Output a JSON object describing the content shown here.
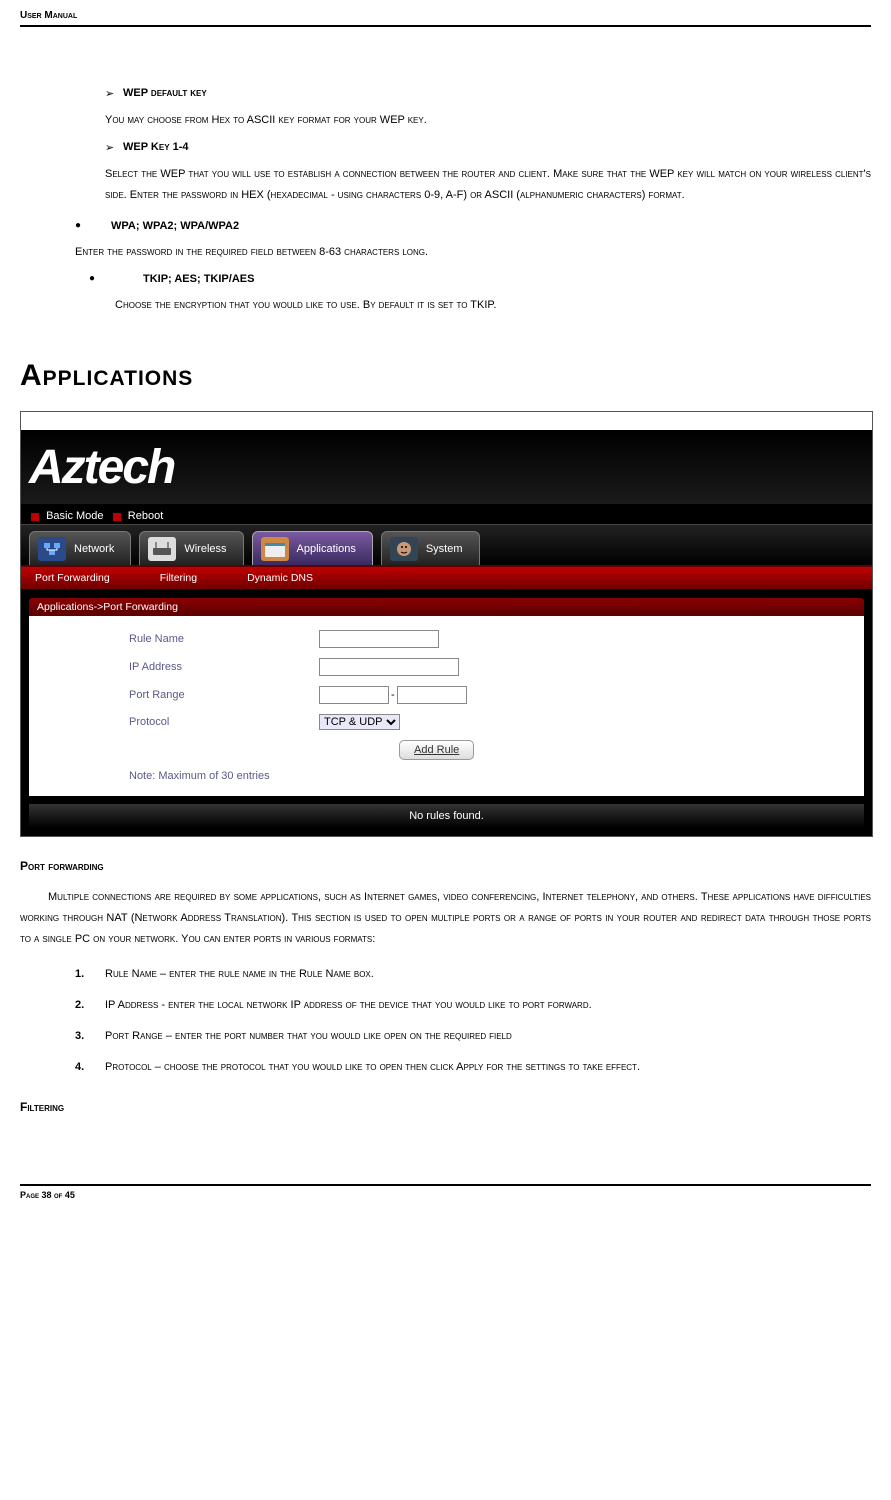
{
  "header": "User Manual",
  "wep": {
    "defaultKey": {
      "title": "WEP default key",
      "desc": "You may choose from Hex to ASCII key format for your WEP key."
    },
    "key14": {
      "title": "WEP Key 1-4",
      "desc": "Select the WEP that you will use to establish a connection between the router and client. Make sure that the WEP key will match on your wireless client's side. Enter the password in HEX (hexadecimal - using characters 0-9, A-F) or ASCII (alphanumeric characters) format."
    }
  },
  "wpa": {
    "title": "WPA; WPA2; WPA/WPA2",
    "desc": "Enter the password in the required field between 8-63 characters long.",
    "sub": {
      "title": "TKIP; AES; TKIP/AES",
      "desc": "Choose the encryption that you would like to use. By default it is set to TKIP."
    }
  },
  "h1": "Applications",
  "screenshot": {
    "logo": "Aztech",
    "topLinks": {
      "basic": "Basic Mode",
      "reboot": "Reboot"
    },
    "tabs": {
      "network": "Network",
      "wireless": "Wireless",
      "applications": "Applications",
      "system": "System"
    },
    "subtabs": {
      "pf": "Port Forwarding",
      "filt": "Filtering",
      "ddns": "Dynamic DNS"
    },
    "crumb": "Applications->Port Forwarding",
    "form": {
      "ruleName": "Rule Name",
      "ip": "IP Address",
      "portRange": "Port Range",
      "protocol": "Protocol",
      "protocolValue": "TCP & UDP",
      "addRule": "Add Rule",
      "note": "Note: Maximum of 30 entries",
      "noRules": "No rules found."
    }
  },
  "portForwarding": {
    "title": "Port forwarding",
    "intro": "Multiple connections are required by some applications, such as Internet games, video conferencing, Internet telephony, and others. These applications have difficulties working through NAT (Network Address Translation). This section is used to open multiple ports or a range of ports in your router and redirect data through those ports to a single PC on your network. You can enter ports in various formats:",
    "items": {
      "1": "Rule Name – enter the rule name in the Rule Name box.",
      "2": "IP Address - enter the local network IP address of the device that you would like to port forward.",
      "3": "Port Range – enter the port number that you would like open on the required field",
      "4": "Protocol – choose the protocol that you would like to open then click Apply for the settings to take effect."
    }
  },
  "filtering": {
    "title": "Filtering"
  },
  "footer": "Page 38 of 45"
}
